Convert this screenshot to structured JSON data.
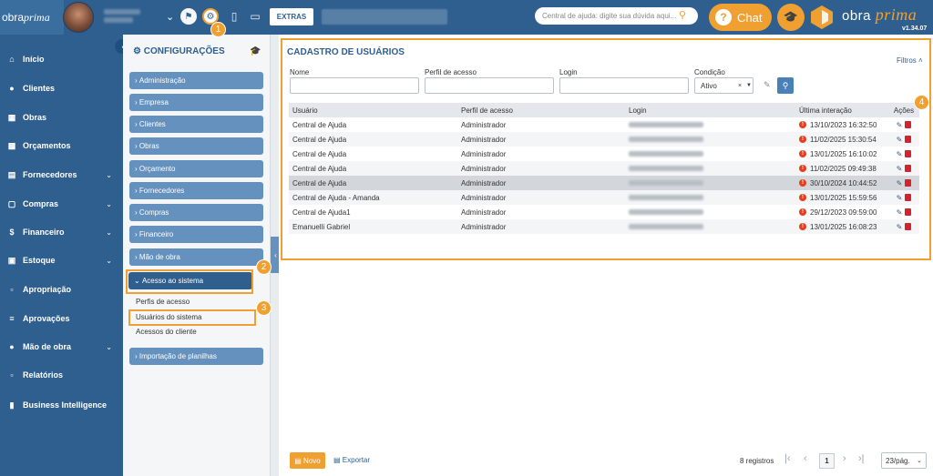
{
  "topbar": {
    "logo_text": "obra",
    "logo_script": "prima",
    "extras_label": "EXTRAS",
    "help_search_placeholder": "Central de ajuda: digite sua dúvida aqui...",
    "chat_label": "Chat",
    "brand_name": "obra",
    "brand_script": "prima",
    "version": "v1.34.07"
  },
  "sidebar": {
    "items": [
      {
        "label": "Início",
        "icon": "home-icon"
      },
      {
        "label": "Clientes",
        "icon": "user-icon"
      },
      {
        "label": "Obras",
        "icon": "building-icon"
      },
      {
        "label": "Orçamentos",
        "icon": "calculator-icon"
      },
      {
        "label": "Fornecedores",
        "icon": "truck-icon",
        "chevron": true
      },
      {
        "label": "Compras",
        "icon": "cart-icon",
        "chevron": true
      },
      {
        "label": "Financeiro",
        "icon": "dollar-icon",
        "chevron": true
      },
      {
        "label": "Estoque",
        "icon": "box-icon",
        "chevron": true
      },
      {
        "label": "Apropriação",
        "icon": "document-icon"
      },
      {
        "label": "Aprovações",
        "icon": "check-list-icon"
      },
      {
        "label": "Mão de obra",
        "icon": "workers-icon",
        "chevron": true
      },
      {
        "label": "Relatórios",
        "icon": "report-icon"
      },
      {
        "label": "Business Intelligence",
        "icon": "bar-chart-icon"
      }
    ]
  },
  "config": {
    "title": "CONFIGURAÇÕES",
    "sections": [
      "Administração",
      "Empresa",
      "Clientes",
      "Obras",
      "Orçamento",
      "Fornecedores",
      "Compras",
      "Financeiro",
      "Mão de obra"
    ],
    "active_section": "Acesso ao sistema",
    "sub_items": [
      "Perfis de acesso",
      "Usuários do sistema",
      "Acessos do cliente"
    ],
    "last_section": "Importação de planilhas"
  },
  "cadastro": {
    "title": "CADASTRO DE USUÁRIOS",
    "filters_label": "Filtros",
    "filter_labels": {
      "nome": "Nome",
      "perfil": "Perfil de acesso",
      "login": "Login",
      "condicao": "Condição"
    },
    "condicao_value": "Ativo",
    "columns": [
      "Usuário",
      "Perfil de acesso",
      "Login",
      "Última interação",
      "Ações"
    ],
    "rows": [
      {
        "usuario": "Central de Ajuda",
        "perfil": "Administrador",
        "data": "13/10/2023 16:32:50"
      },
      {
        "usuario": "Central de Ajuda",
        "perfil": "Administrador",
        "data": "11/02/2025 15:30:54"
      },
      {
        "usuario": "Central de Ajuda",
        "perfil": "Administrador",
        "data": "13/01/2025 16:10:02"
      },
      {
        "usuario": "Central de Ajuda",
        "perfil": "Administrador",
        "data": "11/02/2025 09:49:38"
      },
      {
        "usuario": "Central de Ajuda",
        "perfil": "Administrador",
        "data": "30/10/2024 10:44:52"
      },
      {
        "usuario": "Central de Ajuda - Amanda",
        "perfil": "Administrador",
        "data": "13/01/2025 15:59:56"
      },
      {
        "usuario": "Central de Ajuda1",
        "perfil": "Administrador",
        "data": "29/12/2023 09:59:00"
      },
      {
        "usuario": "Emanuelli Gabriel",
        "perfil": "Administrador",
        "data": "13/01/2025 16:08:23"
      }
    ]
  },
  "footer": {
    "novo_label": "Novo",
    "exportar_label": "Exportar",
    "registros": "8 registros",
    "page": "1",
    "per_page": "23/pág."
  },
  "badges": [
    "1",
    "2",
    "3",
    "4"
  ],
  "colors": {
    "primary": "#2f5f8f",
    "accent": "#f0a030",
    "danger": "#d0262b"
  }
}
